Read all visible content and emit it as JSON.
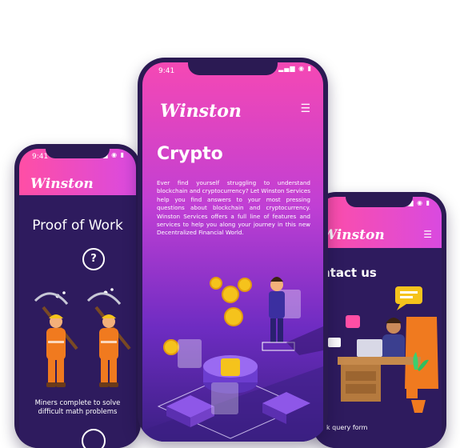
{
  "status_time": "9:41",
  "status_icons": "▂▄▆ ◉ ▮",
  "brand_name": "Winston",
  "menu_icon": "hamburger-icon",
  "left_phone": {
    "title": "Proof of Work",
    "help_glyph": "?",
    "caption_line1": "Miners complete to solve",
    "caption_line2": "difficult math problems"
  },
  "center_phone": {
    "title": "Crypto",
    "body": "Ever find yourself struggling to understand blockchain and cryptocurrency? Let Winston Services help you find answers to your most pressing questions about blockchain and cryptocurrency. Winston Services offers a full line of features and services to help you along your journey in this new Decentralized Financial World."
  },
  "right_phone": {
    "title": "ntact us",
    "caption": "k query form"
  },
  "colors": {
    "brand_pink": "#ff4ea5",
    "brand_purple": "#2e1b5e",
    "accent_orange": "#f07a1f"
  }
}
